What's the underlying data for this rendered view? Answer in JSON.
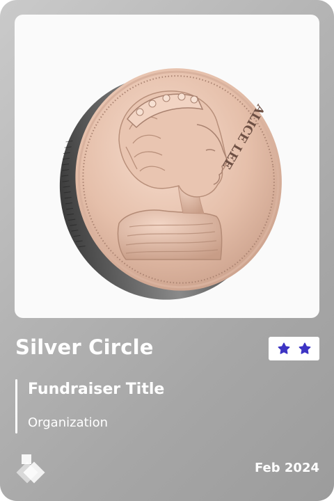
{
  "card": {
    "badge_title": "Silver Circle",
    "star_count": 2,
    "star_color": "#3d34c4",
    "fundraiser_title": "Fundraiser Title",
    "organization": "Organization",
    "date": "Feb 2024",
    "image": {
      "icon": "coin-portrait-image",
      "coin_inscription": "ALICE LEE"
    },
    "logo_icon": "brand-logo-icon"
  }
}
